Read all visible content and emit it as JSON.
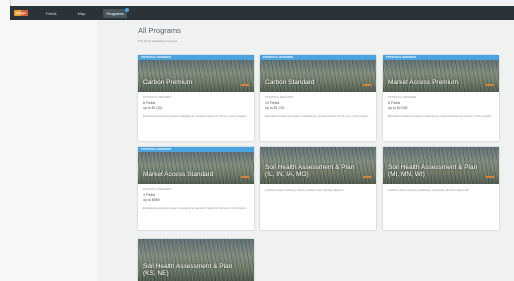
{
  "nav": {
    "logo": "Indigo",
    "items": [
      "Fields",
      "Map",
      "Programs"
    ]
  },
  "page": {
    "title": "All Programs",
    "subtitle": "The list of available programs"
  },
  "cards": [
    {
      "ribbon": "POTENTIAL REWARDS",
      "title": "Carbon Premium",
      "label": "POTENTIAL REWARDS",
      "line1": "8 Fields",
      "line2": "up to $1,001",
      "desc": "Estimated rewards are based on adopting an required practice for the term of the program."
    },
    {
      "ribbon": "POTENTIAL REWARDS",
      "title": "Carbon Standard",
      "label": "POTENTIAL REWARDS",
      "line1": "10 Fields",
      "line2": "up to $1,751",
      "desc": "Estimated rewards are based on adopting an required practice for the term of the program."
    },
    {
      "ribbon": "POTENTIAL REWARDS",
      "title": "Market Access Premium",
      "label": "POTENTIAL REWARDS",
      "line1": "8 Fields",
      "line2": "up to $2,005",
      "desc": "Estimated rewards are based on adopting an required practice for the term of the program."
    },
    {
      "ribbon": "POTENTIAL REWARDS",
      "title": "Market Access Standard",
      "label": "POTENTIAL REWARDS",
      "line1": "4 Fields",
      "line2": "up to $989",
      "desc": "Estimated rewards are based on adopting an required practice for the term of the program."
    },
    {
      "title": "Soil Health Assessment & Plan (IL, IN, IA, MO)",
      "desc": "Limited to select counties in Illinois, Indiana, Iowa, Northern Missouri"
    },
    {
      "title": "Soil Health Assessment & Plan (MI, MN, WI)",
      "desc": "Limited to select counties in Michigan, Minnesota, Southern Wisconsin"
    },
    {
      "title": "Soil Health Assessment & Plan (KS, NE)",
      "desc": ""
    }
  ]
}
